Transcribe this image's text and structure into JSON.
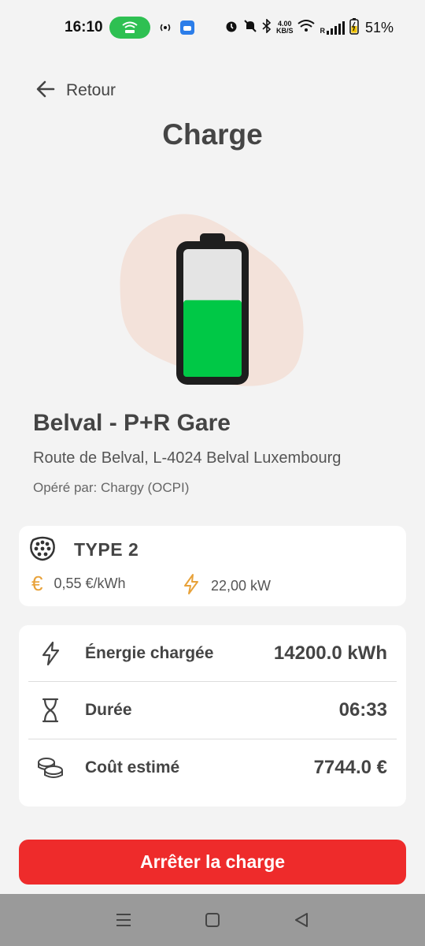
{
  "status_bar": {
    "time": "16:10",
    "net_speed_top": "4.00",
    "net_speed_bottom": "KB/S",
    "signal_label": "R",
    "battery_percent": "51%",
    "hotspot_color": "#2ec052",
    "icons": [
      "hotspot-icon",
      "broadcast-icon",
      "app-notification-icon",
      "alarm-icon",
      "mute-icon",
      "bluetooth-icon",
      "wifi-icon",
      "signal-icon",
      "battery-charging-icon"
    ]
  },
  "header": {
    "back_label": "Retour",
    "title": "Charge"
  },
  "battery_illustration": {
    "fill_level": 0.6,
    "fill_color": "#00c846",
    "blob_color": "#f3e2da"
  },
  "station": {
    "name": "Belval - P+R Gare",
    "address": "Route de Belval, L-4024 Belval Luxembourg",
    "operator": "Opéré par: Chargy (OCPI)"
  },
  "connector": {
    "type": "TYPE 2",
    "price": "0,55 €/kWh",
    "power": "22,00 kW",
    "accent_color": "#e8a23a"
  },
  "stats": [
    {
      "label": "Énergie chargée",
      "value": "14200.0 kWh",
      "icon": "lightning-icon"
    },
    {
      "label": "Durée",
      "value": "06:33",
      "icon": "hourglass-icon"
    },
    {
      "label": "Coût estimé",
      "value": "7744.0 €",
      "icon": "coins-icon"
    }
  ],
  "actions": {
    "stop_label": "Arrêter la charge",
    "stop_color": "#ee2b2b"
  },
  "nav": {
    "items": [
      "menu-icon",
      "home-icon",
      "back-icon"
    ]
  }
}
